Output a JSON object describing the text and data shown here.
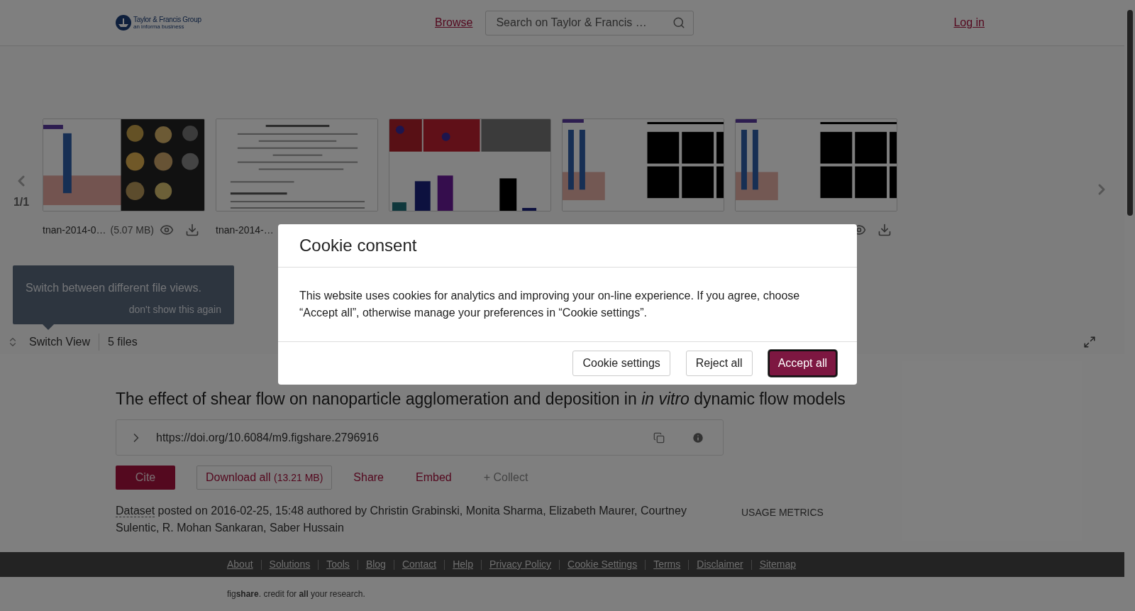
{
  "header": {
    "logo_title": "Taylor & Francis Group",
    "logo_subtitle": "an informa business",
    "nav_link": "Browse",
    "search": {
      "placeholder": "Search on Taylor & Francis …"
    },
    "login": "Log in"
  },
  "carousel": {
    "page": "1/1",
    "files": [
      {
        "kind": "figure-pump",
        "name": "tnan-2014-0…",
        "size": "(5.07 MB)",
        "show_actions": true
      },
      {
        "kind": "document",
        "name": "tnan-2014-…"
      },
      {
        "kind": "figure-bars"
      },
      {
        "kind": "figure-grid"
      },
      {
        "kind": "figure-grid",
        "show_actions": true
      }
    ]
  },
  "tooltip": {
    "text": "Switch between different file views.",
    "dismiss": "don't show this again"
  },
  "toolbar": {
    "switch_view": "Switch View",
    "file_count": "5 files"
  },
  "article": {
    "title": "The effect of shear flow on nanoparticle agglomeration and deposition in *in vitro* dynamic flow models",
    "doi": "https://doi.org/10.6084/m9.figshare.2796916",
    "actions": [
      {
        "kind": "primary",
        "label": "Cite"
      },
      {
        "kind": "outline",
        "label": "Download all",
        "note": "(13.21 MB)"
      },
      {
        "kind": "link",
        "label": "Share"
      },
      {
        "kind": "link",
        "label": "Embed"
      },
      {
        "kind": "muted",
        "label": "+ Collect"
      }
    ],
    "item_type": "Dataset",
    "posted": "posted on 2016-02-25, 15:48 authored by Christin Grabinski, Monita Sharma, Elizabeth Maurer, Courtney Sulentic, R. Mohan Sankaran, Saber Hussain",
    "usage_metrics": "USAGE METRICS"
  },
  "footer": {
    "links": [
      "About",
      "Solutions",
      "Tools",
      "Blog",
      "Contact",
      "Help",
      "Privacy Policy",
      "Cookie Settings",
      "Terms",
      "Disclaimer",
      "Sitemap"
    ],
    "tagline": "fig**share**. credit for **all** your research."
  },
  "cookie_dialog": {
    "title": "Cookie consent",
    "body": "This website uses cookies for analytics and improving your on-line experience. If you agree, choose “Accept all”, otherwise manage your preferences in “Cookie settings”.",
    "buttons": [
      {
        "kind": "secondary",
        "label": "Cookie settings"
      },
      {
        "kind": "secondary",
        "label": "Reject all"
      },
      {
        "kind": "primary",
        "label": "Accept all"
      }
    ]
  }
}
